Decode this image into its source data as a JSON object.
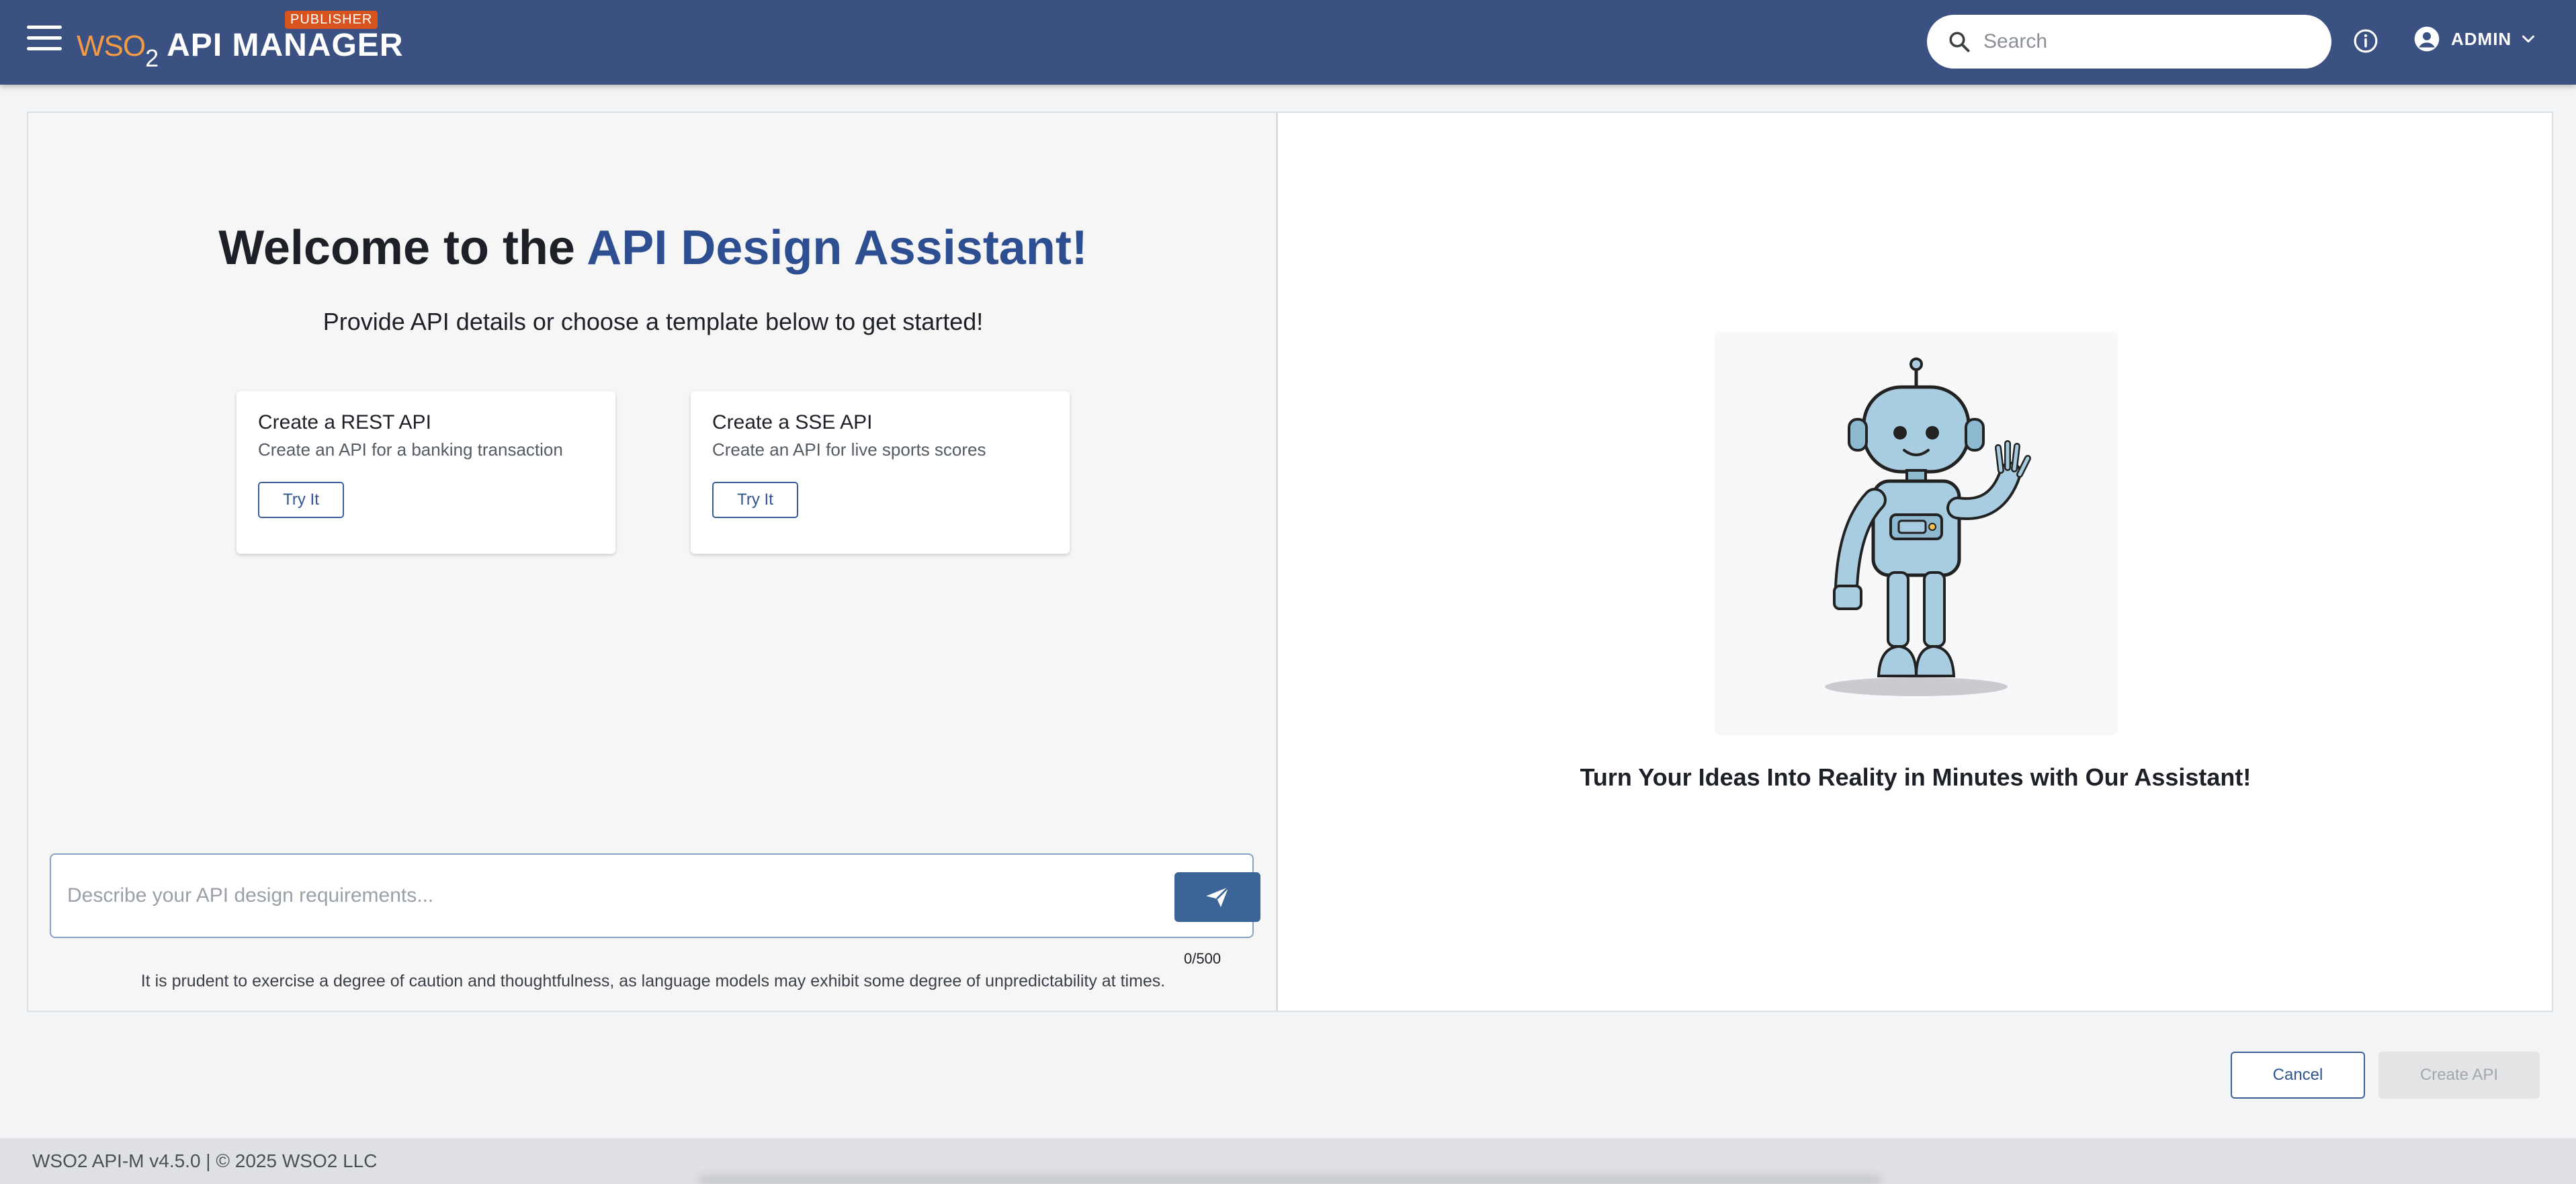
{
  "header": {
    "logo_brand": "WSO",
    "logo_sub": "2",
    "logo_product": "API MANAGER",
    "badge": "PUBLISHER",
    "search_placeholder": "Search",
    "user_name": "ADMIN",
    "icons": [
      "menu-icon",
      "search-icon",
      "info-icon",
      "account-circle-icon",
      "chevron-down-icon"
    ]
  },
  "welcome": {
    "title_prefix": "Welcome to the ",
    "title_highlight": "API Design Assistant!",
    "subtitle": "Provide API details or choose a template below to get started!"
  },
  "templates": [
    {
      "title": "Create a REST API",
      "description": "Create an API for a banking transaction",
      "button": "Try It"
    },
    {
      "title": "Create a SSE API",
      "description": "Create an API for live sports scores",
      "button": "Try It"
    }
  ],
  "prompt": {
    "placeholder": "Describe your API design requirements...",
    "counter": "0/500",
    "disclaimer": "It is prudent to exercise a degree of caution and thoughtfulness, as language models may exhibit some degree of unpredictability at times."
  },
  "illustration": {
    "tagline": "Turn Your Ideas Into Reality in Minutes with Our Assistant!"
  },
  "actions": {
    "cancel": "Cancel",
    "create": "Create API"
  },
  "footer": {
    "text": "WSO2 API-M v4.5.0 | © 2025 WSO2 LLC"
  },
  "colors": {
    "header_bg": "#3a5181",
    "accent_blue": "#2d4f92",
    "brand_orange": "#f29a45",
    "badge_red": "#d9531e",
    "send_button": "#3b6597"
  }
}
